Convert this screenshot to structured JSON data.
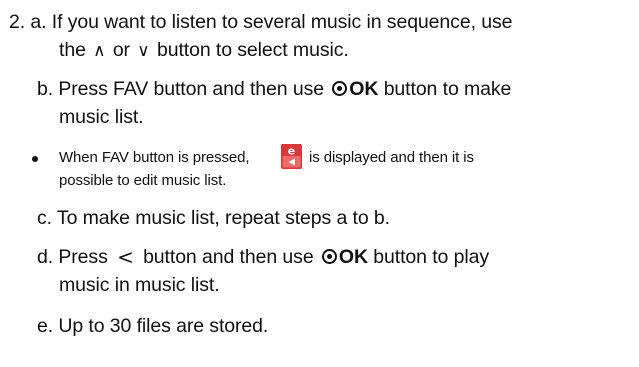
{
  "step2": {
    "a_line1": "2. a. If you want to listen to several music in sequence, use",
    "a_line2_pre": "the",
    "a_up_arrow": "∧",
    "a_or": "or",
    "a_down_arrow": "∨",
    "a_line2_post": "button to select music.",
    "b_line1_pre": "b. Press FAV button and then use",
    "ok_label": "OK",
    "b_line1_post": "button to make",
    "b_line2": "music list.",
    "note_line1_pre": "When FAV button is pressed,",
    "note_line1_post": "is displayed and then it is",
    "note_line2": "possible to edit music list.",
    "c_line": "c. To make music list, repeat steps a to b.",
    "d_line1_pre": "d. Press",
    "d_left_arrow": "<",
    "d_line1_mid": "button and then use",
    "d_line1_post": "button to play",
    "d_line2": "music in music list.",
    "e_line": "e. Up to 30 files are stored."
  },
  "icons": {
    "ok": "ok-button-icon",
    "fav": "edit-list-icon",
    "fav_letter": "e",
    "fav_top_color": "#d9383a",
    "fav_bottom_color": "#ec6a6a"
  }
}
